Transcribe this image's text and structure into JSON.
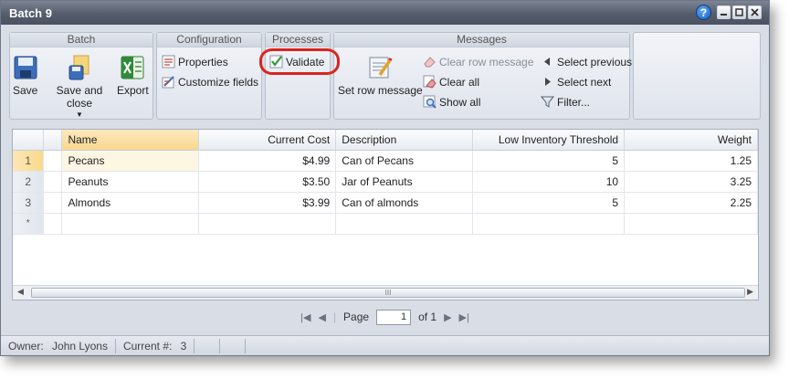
{
  "window": {
    "title": "Batch 9",
    "help": "?",
    "minimize": "_",
    "maximize": "□",
    "close": "×"
  },
  "ribbon": {
    "batch": {
      "title": "Batch",
      "save": "Save",
      "save_and_close": "Save and close",
      "export": "Export"
    },
    "configuration": {
      "title": "Configuration",
      "properties": "Properties",
      "customize_fields": "Customize fields"
    },
    "processes": {
      "title": "Processes",
      "validate": "Validate"
    },
    "messages": {
      "title": "Messages",
      "set_row_message": "Set row message",
      "clear_row_message": "Clear row message",
      "clear_all": "Clear all",
      "show_all": "Show all",
      "select_previous": "Select previous",
      "select_next": "Select next",
      "filter": "Filter..."
    }
  },
  "grid": {
    "columns": [
      "Name",
      "Current Cost",
      "Description",
      "Low Inventory Threshold",
      "Weight"
    ],
    "rows": [
      {
        "num": "1",
        "name": "Pecans",
        "cost": "$4.99",
        "description": "Can of Pecans",
        "threshold": "5",
        "weight": "1.25"
      },
      {
        "num": "2",
        "name": "Peanuts",
        "cost": "$3.50",
        "description": "Jar of Peanuts",
        "threshold": "10",
        "weight": "3.25"
      },
      {
        "num": "3",
        "name": "Almonds",
        "cost": "$3.99",
        "description": "Can of almonds",
        "threshold": "5",
        "weight": "2.25"
      }
    ],
    "new_row_marker": "*",
    "scroll_grip": "III"
  },
  "pager": {
    "page_label": "Page",
    "page_value": "1",
    "of_label": "of 1"
  },
  "status": {
    "owner_label": "Owner:",
    "owner_value": "John Lyons",
    "current_label": "Current #:",
    "current_value": "3"
  },
  "colors": {
    "highlight_ring": "#d9251f",
    "title_bar": "#555d6c"
  }
}
